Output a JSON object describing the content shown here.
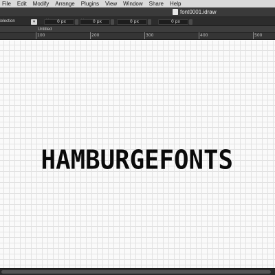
{
  "menubar": {
    "items": [
      "File",
      "Edit",
      "Modify",
      "Arrange",
      "Plugins",
      "View",
      "Window",
      "Share",
      "Help"
    ]
  },
  "window": {
    "title": "font0001.idraw"
  },
  "toolbar": {
    "tool_label": "Selection",
    "x_label": "X:",
    "x_value": "0 px",
    "y_label": "Y:",
    "y_value": "0 px",
    "w_value": "0 px",
    "h_value": "0 px"
  },
  "tabs": {
    "active": "Untitled"
  },
  "ruler": {
    "labels": [
      "100",
      "200",
      "300",
      "400",
      "500"
    ]
  },
  "canvas": {
    "text": "HAMBURGEFONTS"
  },
  "icons": {
    "document": "document-icon",
    "tool": "selection-tool-icon",
    "width": "width-icon",
    "height": "height-icon"
  }
}
